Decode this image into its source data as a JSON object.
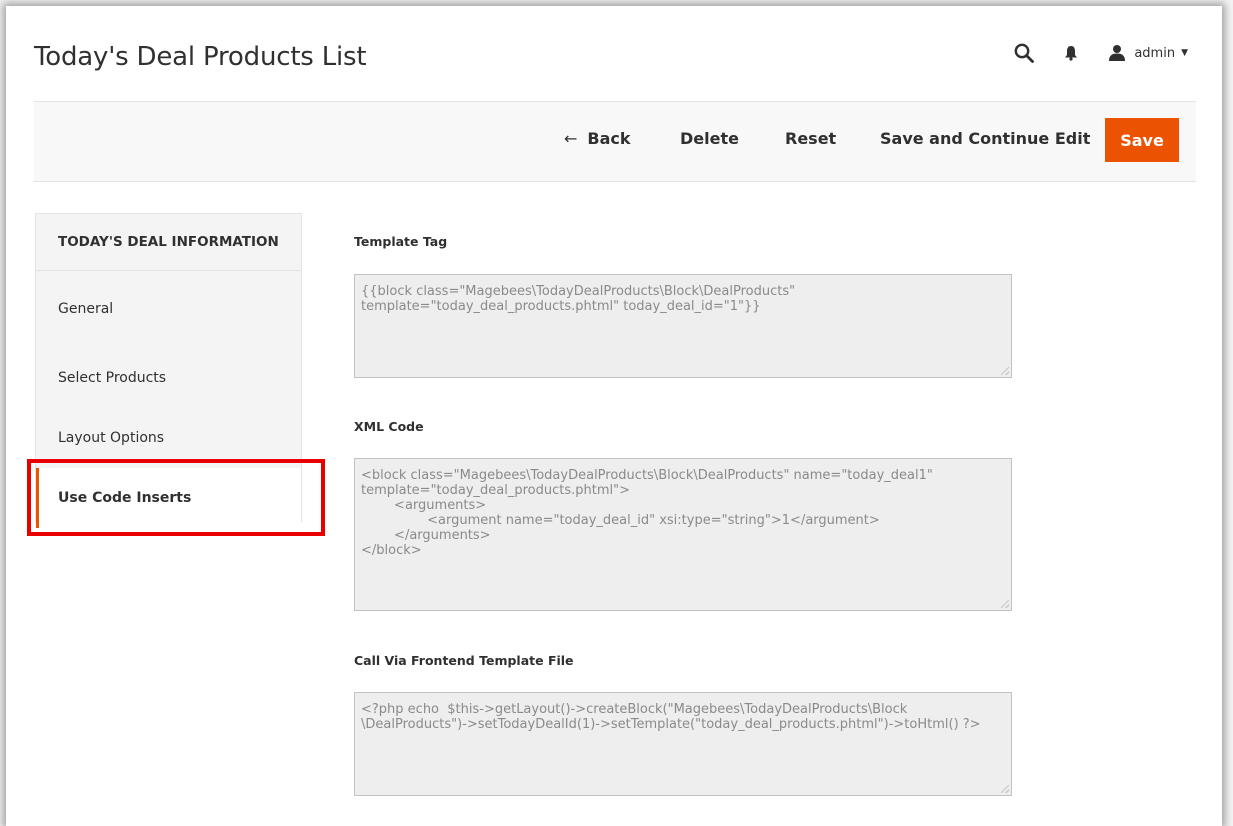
{
  "page": {
    "title": "Today's Deal Products List"
  },
  "header": {
    "user_name": "admin",
    "icons": [
      "search-icon",
      "bell-icon",
      "user-icon",
      "caret-down-icon"
    ]
  },
  "toolbar": {
    "back_label": "Back",
    "delete_label": "Delete",
    "reset_label": "Reset",
    "save_continue_label": "Save and Continue Edit",
    "save_label": "Save"
  },
  "sidebar": {
    "title": "TODAY'S DEAL INFORMATION",
    "items": [
      {
        "label": "General"
      },
      {
        "label": "Select Products"
      },
      {
        "label": "Layout Options"
      },
      {
        "label": "Use Code Inserts"
      }
    ],
    "active_item": "Use Code Inserts"
  },
  "sections": {
    "template_tag": {
      "label": "Template Tag",
      "lines": [
        "{{block class=\"Magebees\\TodayDealProducts\\Block\\DealProducts\"",
        "template=\"today_deal_products.phtml\" today_deal_id=\"1\"}}"
      ]
    },
    "xml_code": {
      "label": "XML Code",
      "lines": [
        "<block class=\"Magebees\\TodayDealProducts\\Block\\DealProducts\" name=\"today_deal1\"",
        "template=\"today_deal_products.phtml\">",
        "        <arguments>",
        "                <argument name=\"today_deal_id\" xsi:type=\"string\">1</argument>",
        "        </arguments>",
        "</block>"
      ]
    },
    "frontend_template": {
      "label": "Call Via Frontend Template File",
      "lines": [
        "<?php echo  $this->getLayout()->createBlock(\"Magebees\\TodayDealProducts\\Block",
        "\\DealProducts\")->setTodayDealId(1)->setTemplate(\"today_deal_products.phtml\")->toHtml() ?>"
      ]
    }
  },
  "colors": {
    "accent": "#eb5202",
    "highlight": "#e80000"
  }
}
